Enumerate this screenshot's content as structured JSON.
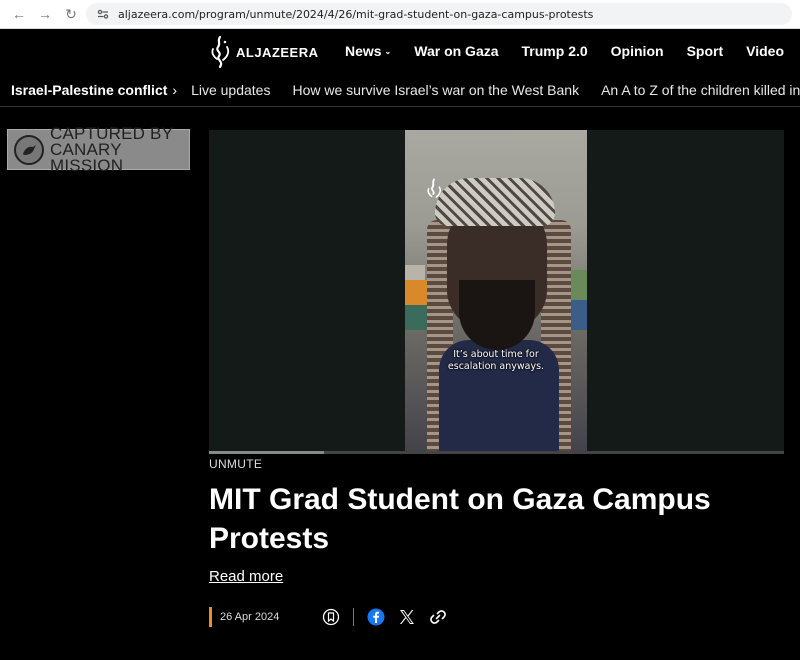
{
  "browser": {
    "url": "aljazeera.com/program/unmute/2024/4/26/mit-grad-student-on-gaza-campus-protests"
  },
  "header": {
    "logo_text": "ALJAZEERA",
    "nav": [
      "News",
      "War on Gaza",
      "Trump 2.0",
      "Opinion",
      "Sport",
      "Video"
    ]
  },
  "subnav": {
    "topic": "Israel-Palestine conflict",
    "links": [
      "Live updates",
      "How we survive Israel’s war on the West Bank",
      "An A to Z of the children killed in Gaza"
    ]
  },
  "badge": {
    "line1": "CAPTURED BY",
    "line2": "CANARY MISSION"
  },
  "video": {
    "caption_line1": "It’s about time for",
    "caption_line2": "escalation anyways.",
    "progress": 0.2
  },
  "article": {
    "category": "UNMUTE",
    "headline": "MIT Grad Student on Gaza Campus Protests",
    "read_more": "Read more",
    "date": "26 Apr 2024"
  },
  "colors": {
    "background": "#000000",
    "date_accent": "#f28c28",
    "facebook": "#1877f2"
  }
}
